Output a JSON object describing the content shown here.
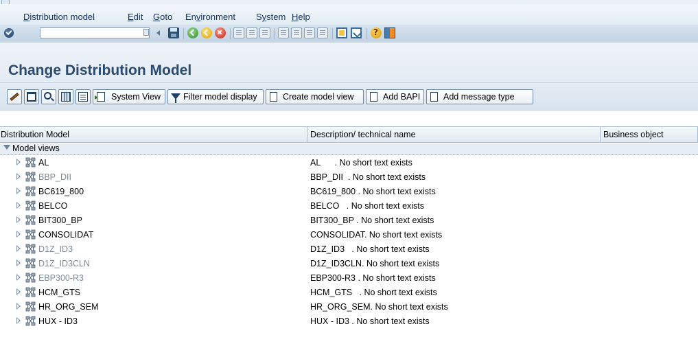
{
  "menubar": {
    "items": [
      {
        "label": "Distribution model",
        "underline_index": 0
      },
      {
        "label": "Edit",
        "underline_index": 0
      },
      {
        "label": "Goto",
        "underline_index": 0
      },
      {
        "label": "Environment",
        "underline_index": 2
      },
      {
        "label": "System",
        "underline_index": 1
      },
      {
        "label": "Help",
        "underline_index": 0
      }
    ]
  },
  "std_toolbar": {
    "command_field_value": ""
  },
  "page": {
    "title": "Change Distribution Model"
  },
  "app_toolbar": {
    "system_view": "System View",
    "filter_model_display": "Filter model display",
    "create_model_view": "Create model view",
    "add_bapi": "Add BAPI",
    "add_message_type": "Add message type"
  },
  "tree": {
    "columns": {
      "distribution_model": "Distribution Model",
      "description": "Description/ technical name",
      "business_object": "Business object"
    },
    "root": {
      "label": "Model views",
      "expanded": true
    },
    "rows": [
      {
        "name": "AL",
        "description": "AL      . No short text exists",
        "dim": false
      },
      {
        "name": "BBP_DII",
        "description": "BBP_DII  . No short text exists",
        "dim": true
      },
      {
        "name": "BC619_800",
        "description": "BC619_800 . No short text exists",
        "dim": false
      },
      {
        "name": "BELCO",
        "description": "BELCO   . No short text exists",
        "dim": false
      },
      {
        "name": "BIT300_BP",
        "description": "BIT300_BP . No short text exists",
        "dim": false
      },
      {
        "name": "CONSOLIDAT",
        "description": "CONSOLIDAT. No short text exists",
        "dim": false
      },
      {
        "name": "D1Z_ID3",
        "description": "D1Z_ID3   . No short text exists",
        "dim": true
      },
      {
        "name": "D1Z_ID3CLN",
        "description": "D1Z_ID3CLN. No short text exists",
        "dim": true
      },
      {
        "name": "EBP300-R3",
        "description": "EBP300-R3 . No short text exists",
        "dim": true
      },
      {
        "name": "HCM_GTS",
        "description": "HCM_GTS   . No short text exists",
        "dim": false
      },
      {
        "name": "HR_ORG_SEM",
        "description": "HR_ORG_SEM. No short text exists",
        "dim": false
      },
      {
        "name": "HUX - ID3",
        "description": "HUX - ID3 . No short text exists",
        "dim": false
      }
    ]
  }
}
